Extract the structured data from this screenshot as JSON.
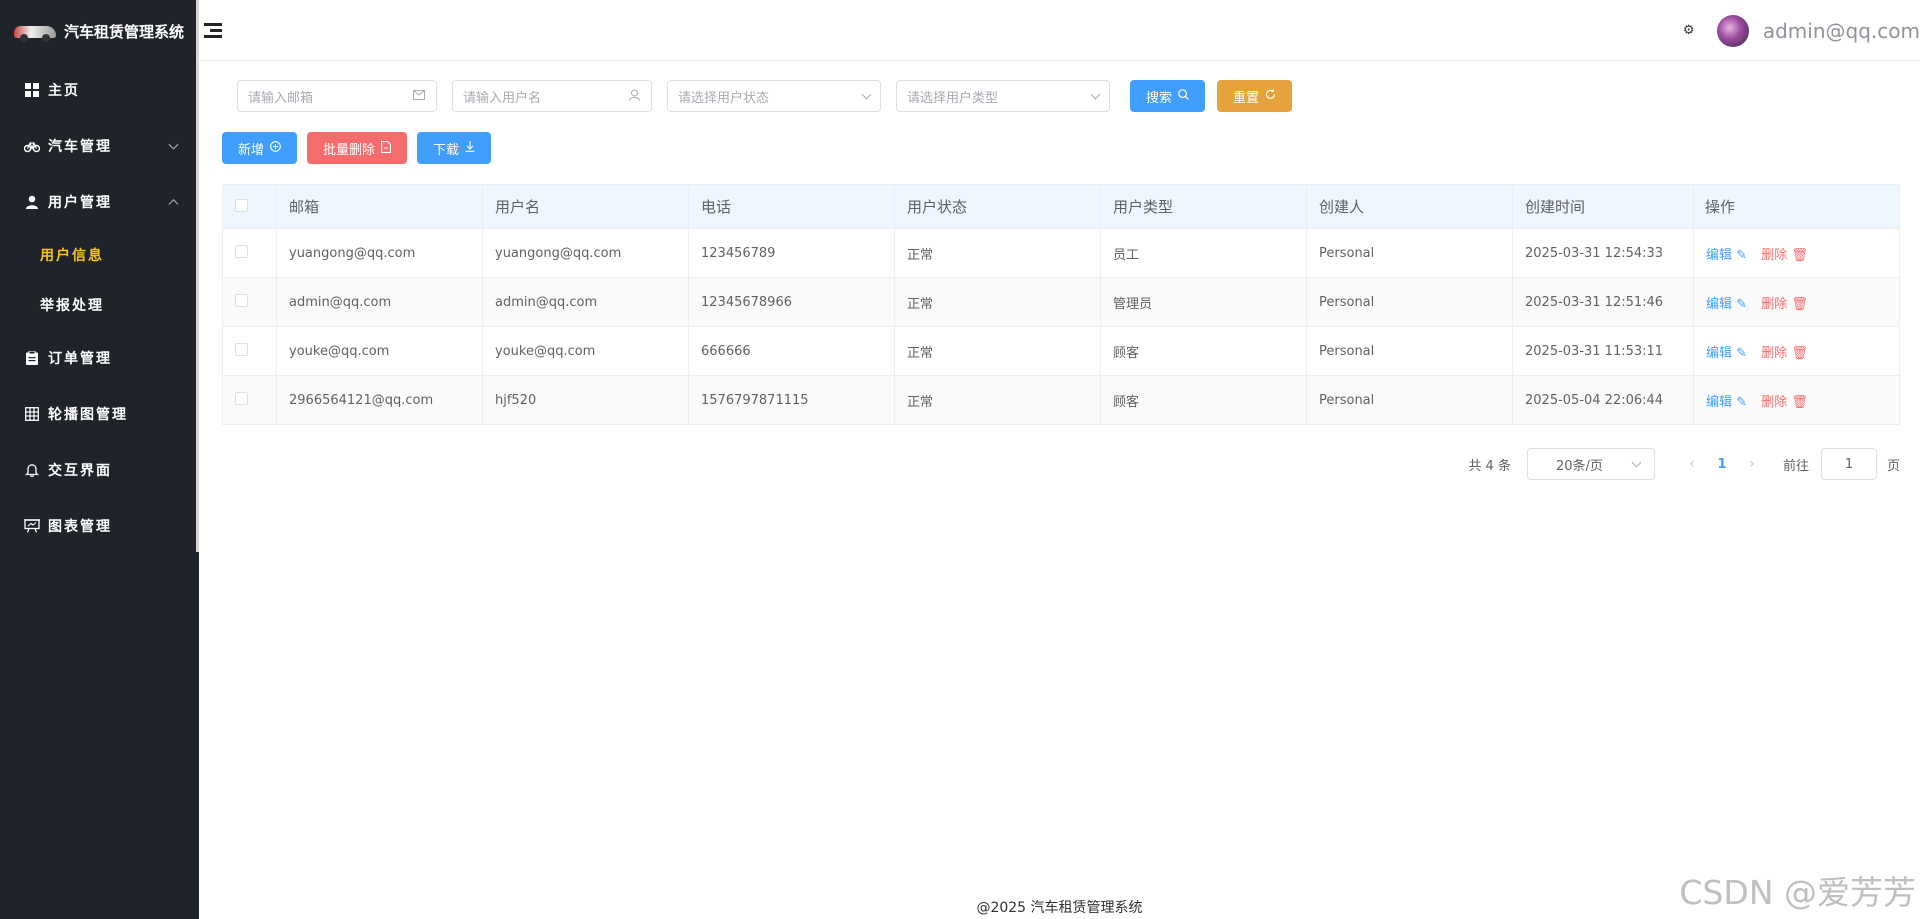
{
  "app": {
    "title": "汽车租赁管理系统"
  },
  "sidebar": {
    "items": [
      {
        "label": "主页",
        "icon": "grid-icon"
      },
      {
        "label": "汽车管理",
        "icon": "bicycle-icon"
      },
      {
        "label": "用户管理",
        "icon": "user-icon"
      },
      {
        "label": "订单管理",
        "icon": "clipboard-icon"
      },
      {
        "label": "轮播图管理",
        "icon": "table-icon"
      },
      {
        "label": "交互界面",
        "icon": "bell-icon"
      },
      {
        "label": "图表管理",
        "icon": "presentation-icon"
      }
    ],
    "sub_items": [
      {
        "label": "用户信息",
        "active": true
      },
      {
        "label": "举报处理",
        "active": false
      }
    ],
    "active_color": "#f5c518"
  },
  "header": {
    "username": "admin@qq.com"
  },
  "filters": {
    "email_placeholder": "请输入邮箱",
    "username_placeholder": "请输入用户名",
    "status_placeholder": "请选择用户状态",
    "type_placeholder": "请选择用户类型",
    "search_label": "搜索",
    "reset_label": "重置"
  },
  "actions": {
    "add_label": "新增",
    "batch_delete_label": "批量删除",
    "download_label": "下载"
  },
  "table": {
    "headers": [
      "邮箱",
      "用户名",
      "电话",
      "用户状态",
      "用户类型",
      "创建人",
      "创建时间",
      "操作"
    ],
    "rows": [
      {
        "email": "yuangong@qq.com",
        "username": "yuangong@qq.com",
        "phone": "123456789",
        "status": "正常",
        "type": "员工",
        "creator": "Personal",
        "created": "2025-03-31 12:54:33"
      },
      {
        "email": "admin@qq.com",
        "username": "admin@qq.com",
        "phone": "12345678966",
        "status": "正常",
        "type": "管理员",
        "creator": "Personal",
        "created": "2025-03-31 12:51:46"
      },
      {
        "email": "youke@qq.com",
        "username": "youke@qq.com",
        "phone": "666666",
        "status": "正常",
        "type": "顾客",
        "creator": "Personal",
        "created": "2025-03-31 11:53:11"
      },
      {
        "email": "2966564121@qq.com",
        "username": "hjf520",
        "phone": "1576797871115",
        "status": "正常",
        "type": "顾客",
        "creator": "Personal",
        "created": "2025-05-04 22:06:44"
      }
    ],
    "edit_label": "编辑",
    "delete_label": "删除"
  },
  "pagination": {
    "total": "共 4 条",
    "page_size": "20条/页",
    "current_page": "1",
    "goto_label": "前往",
    "goto_value": "1",
    "page_suffix": "页"
  },
  "footer": {
    "text": "@2025 汽车租赁管理系统"
  },
  "watermark": "CSDN @爱芳芳",
  "colors": {
    "primary": "#409eff",
    "warning": "#e6a23c",
    "danger": "#f56c6c",
    "sidebar_bg": "#1f232a"
  }
}
